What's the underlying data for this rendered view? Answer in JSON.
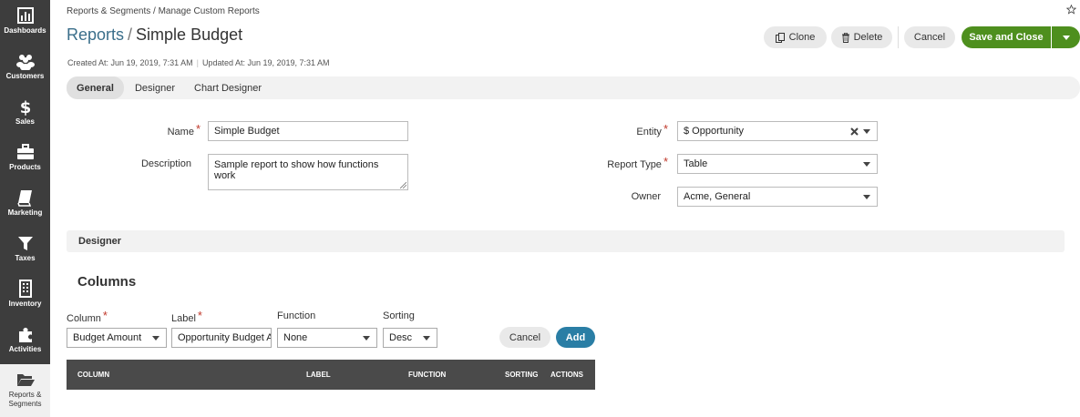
{
  "sidebar": {
    "items": [
      {
        "label": "Dashboards",
        "icon": "bar-chart-icon"
      },
      {
        "label": "Customers",
        "icon": "users-icon"
      },
      {
        "label": "Sales",
        "icon": "dollar-icon"
      },
      {
        "label": "Products",
        "icon": "briefcase-icon"
      },
      {
        "label": "Marketing",
        "icon": "book-icon"
      },
      {
        "label": "Taxes",
        "icon": "filter-icon"
      },
      {
        "label": "Inventory",
        "icon": "building-icon"
      },
      {
        "label": "Activities",
        "icon": "puzzle-icon"
      },
      {
        "label_line1": "Reports &",
        "label_line2": "Segments",
        "icon": "folder-open-icon",
        "active": true
      }
    ]
  },
  "breadcrumb": "Reports & Segments / Manage Custom Reports",
  "title": {
    "section": "Reports",
    "separator": "/",
    "name": "Simple Budget"
  },
  "meta": {
    "created": "Created At: Jun 19, 2019, 7:31 AM",
    "updated": "Updated At: Jun 19, 2019, 7:31 AM"
  },
  "toolbar": {
    "clone": "Clone",
    "delete": "Delete",
    "cancel": "Cancel",
    "save_close": "Save and Close"
  },
  "tabs": [
    "General",
    "Designer",
    "Chart Designer"
  ],
  "form": {
    "name_label": "Name",
    "name_value": "Simple Budget",
    "description_label": "Description",
    "description_value": "Sample report to show how functions work",
    "entity_label": "Entity",
    "entity_value": "$ Opportunity",
    "report_type_label": "Report Type",
    "report_type_value": "Table",
    "owner_label": "Owner",
    "owner_value": "Acme, General"
  },
  "designer_section": "Designer",
  "columns": {
    "title": "Columns",
    "column_label": "Column",
    "column_value": "Budget Amount",
    "label_label": "Label",
    "label_value": "Opportunity Budget Amount",
    "function_label": "Function",
    "function_value": "None",
    "sorting_label": "Sorting",
    "sorting_value": "Desc",
    "cancel": "Cancel",
    "add": "Add"
  },
  "table_headers": [
    "COLUMN",
    "LABEL",
    "FUNCTION",
    "SORTING",
    "ACTIONS"
  ],
  "colors": {
    "accent": "#2a7ea5",
    "save": "#4e8f1e",
    "sidebar": "#3d3d3d",
    "required": "#c0392b"
  }
}
